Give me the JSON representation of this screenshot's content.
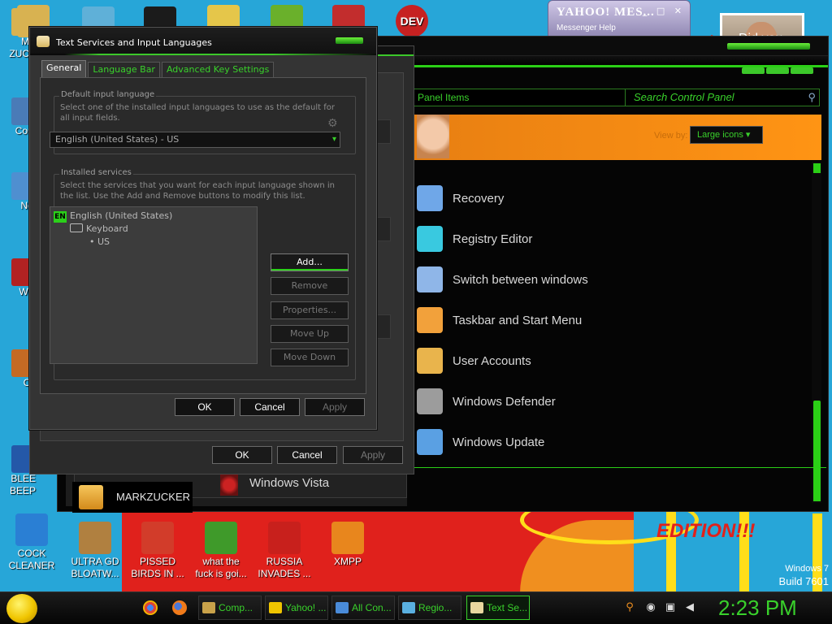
{
  "desktop": {
    "icons_left": [
      {
        "label": "MA\nZUCK",
        "color": "#d8b251"
      },
      {
        "label": "Com",
        "color": "#4a7bb7"
      },
      {
        "label": "Net",
        "color": "#4f8fd0"
      },
      {
        "label": "Win\nV",
        "color": "#b22222"
      },
      {
        "label": "Co\nP",
        "color": "#c46a24"
      },
      {
        "label": "BLEE\nBEEP",
        "color": "#2458a8"
      }
    ],
    "icons_top": [
      {
        "label": "",
        "color": "#d8b251"
      },
      {
        "label": "",
        "color": "#5fb0d8"
      },
      {
        "label": "",
        "color": "#1b1b1b"
      },
      {
        "label": "",
        "color": "#e5c64a"
      },
      {
        "label": "",
        "color": "#6ab02b"
      },
      {
        "label": "",
        "color": "#c22d2d"
      },
      {
        "label": "DEV",
        "color": "#c62121"
      }
    ],
    "icons_bottom": [
      {
        "label": "COCK\nCLEANER",
        "color": "#2a7fd4"
      },
      {
        "label": "ULTRA GD\nBLOATW...",
        "color": "#b08040"
      },
      {
        "label": "PISSED\nBIRDS IN ...",
        "color": "#d23c2a"
      },
      {
        "label": "what the\nfuck is goi...",
        "color": "#3f9a2a"
      },
      {
        "label": "RUSSIA\nINVADES ...",
        "color": "#c8201c"
      },
      {
        "label": "XMPP",
        "color": "#e8861d"
      }
    ],
    "wallpaper_text": "EDITION!!!",
    "os_label": "Windows 7",
    "build_label": "Build 7601",
    "photo_caption": "Did you"
  },
  "yahoo": {
    "title": "YAHOO! MES...",
    "menu": "Messenger   Help",
    "controls": "_ □ ✕"
  },
  "control_panel": {
    "breadcrumb": "Panel Items",
    "search_placeholder": "Search Control Panel",
    "view_by_label": "View by:",
    "view_by_value": "Large icons",
    "items": [
      {
        "label": "Recovery",
        "icon": "recovery-icon",
        "color": "#6fa7e8"
      },
      {
        "label": "Registry Editor",
        "icon": "registry-editor-icon",
        "color": "#39c9e0"
      },
      {
        "label": "Switch between windows",
        "icon": "switch-windows-icon",
        "color": "#8fb6e8"
      },
      {
        "label": "Taskbar and Start Menu",
        "icon": "taskbar-icon",
        "color": "#f2a13b"
      },
      {
        "label": "User Accounts",
        "icon": "user-accounts-icon",
        "color": "#e9b44c"
      },
      {
        "label": "Windows Defender",
        "icon": "windows-defender-icon",
        "color": "#9c9c9c"
      },
      {
        "label": "Windows Update",
        "icon": "windows-update-icon",
        "color": "#5aa0e3"
      }
    ],
    "vista_label": "Windows Vista",
    "user_label": "MARKZUCKER"
  },
  "back_dialog": {
    "ok": "OK",
    "cancel": "Cancel",
    "apply": "Apply"
  },
  "dialog": {
    "title": "Text Services and Input Languages",
    "tabs": [
      "General",
      "Language Bar",
      "Advanced Key Settings"
    ],
    "default_group_title": "Default input language",
    "default_group_desc": "Select one of the installed input languages to use as the default for all input fields.",
    "default_language": "English (United States) - US",
    "services_group_title": "Installed services",
    "services_group_desc": "Select the services that you want for each input language shown in the list. Use the Add and Remove buttons to modify this list.",
    "tree": {
      "lang_code": "EN",
      "language": "English (United States)",
      "keyboard": "Keyboard",
      "layout": "US"
    },
    "side_buttons": {
      "add": "Add...",
      "remove": "Remove",
      "properties": "Properties...",
      "move_up": "Move Up",
      "move_down": "Move Down"
    },
    "ok": "OK",
    "cancel": "Cancel",
    "apply": "Apply"
  },
  "taskbar": {
    "buttons": [
      {
        "label": "Comp...",
        "color": "#c9a24a"
      },
      {
        "label": "Yahoo! ...",
        "color": "#f0c500"
      },
      {
        "label": "All Con...",
        "color": "#4a8bd8"
      },
      {
        "label": "Regio...",
        "color": "#5ab0e0"
      },
      {
        "label": "Text Se...",
        "color": "#e8d8a0"
      }
    ],
    "clock": "2:23 PM"
  }
}
